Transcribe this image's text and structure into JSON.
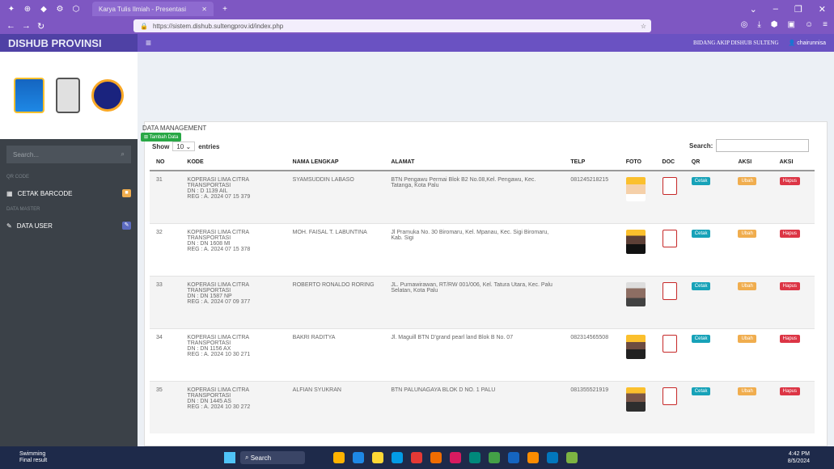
{
  "browser": {
    "tab_title": "Karya Tulis Ilmiah - Presentasi",
    "url": "https://sistem.dishub.sultengprov.id/index.php"
  },
  "header": {
    "brand": "DISHUB PROVINSI",
    "right_label": "BIDANG AKIP DISHUB SULTENG",
    "user": "chairunnisa"
  },
  "sidebar": {
    "search_placeholder": "Search...",
    "section1": "QR CODE",
    "item1": "CETAK BARCODE",
    "section2": "DATA MASTER",
    "item2": "DATA USER"
  },
  "main": {
    "add_button": "Tambah Data",
    "title": "DATA MANAGEMENT",
    "show": "Show",
    "entries_value": "10",
    "entries": "entries",
    "search_label": "Search:"
  },
  "table": {
    "headers": [
      "NO",
      "KODE",
      "NAMA LENGKAP",
      "ALAMAT",
      "TELP",
      "FOTO",
      "DOC",
      "QR",
      "AKSI",
      "AKSI"
    ],
    "btn_cetak": "Cetak",
    "btn_ubah": "Ubah",
    "btn_hapus": "Hapus",
    "rows": [
      {
        "no": "31",
        "kode1": "KOPERASI LIMA CITRA",
        "kode2": "TRANSPORTASI",
        "kode3": "DN : D 1139 AIL",
        "kode4": "REG : A. 2024 07 15 379",
        "nama": "SYAMSUDDIN LABASO",
        "alamat": "BTN Pengawu Permai Blok B2 No.08,Kel. Pengawu, Kec. Tatanga, Kota Palu",
        "telp": "081245218215"
      },
      {
        "no": "32",
        "kode1": "KOPERASI LIMA CITRA",
        "kode2": "TRANSPORTASI",
        "kode3": "DN : DN 1608 MI",
        "kode4": "REG : A. 2024 07 15 378",
        "nama": "MOH. FAISAL T. LABUNTINA",
        "alamat": "Jl Pramuka No. 30 Biromaru, Kel. Mpanau, Kec. Sigi Biromaru, Kab. Sigi",
        "telp": ""
      },
      {
        "no": "33",
        "kode1": "KOPERASI LIMA CITRA",
        "kode2": "TRANSPORTASI",
        "kode3": "DN : DN 1587 NP",
        "kode4": "REG : A. 2024 07 09 377",
        "nama": "ROBERTO RONALDO RORING",
        "alamat": "JL. Purnawirawan, RT/RW 001/006, Kel. Tatura Utara, Kec. Palu Selatan, Kota Palu",
        "telp": ""
      },
      {
        "no": "34",
        "kode1": "KOPERASI LIMA CITRA",
        "kode2": "TRANSPORTASI",
        "kode3": "DN : DN 1156 AX",
        "kode4": "REG : A. 2024 10 30 271",
        "nama": "BAKRI RADITYA",
        "alamat": "Jl. Maguill BTN D'grand pearl land Blok B No. 07",
        "telp": "082314565508"
      },
      {
        "no": "35",
        "kode1": "KOPERASI LIMA CITRA",
        "kode2": "TRANSPORTASI",
        "kode3": "DN : DN 1445 AS",
        "kode4": "REG : A. 2024 10 30 272",
        "nama": "ALFIAN SYUKRAN",
        "alamat": "BTN PALUNAGAYA BLOK D NO. 1 PALU",
        "telp": "081355521919"
      }
    ]
  },
  "taskbar": {
    "weather1": "Swimming",
    "weather2": "Final result",
    "search": "Search",
    "time": "4:42 PM",
    "date": "8/5/2024"
  },
  "colors": {
    "purple": "#7e57c2",
    "sidebar": "#3b4148",
    "green": "#28a745"
  }
}
